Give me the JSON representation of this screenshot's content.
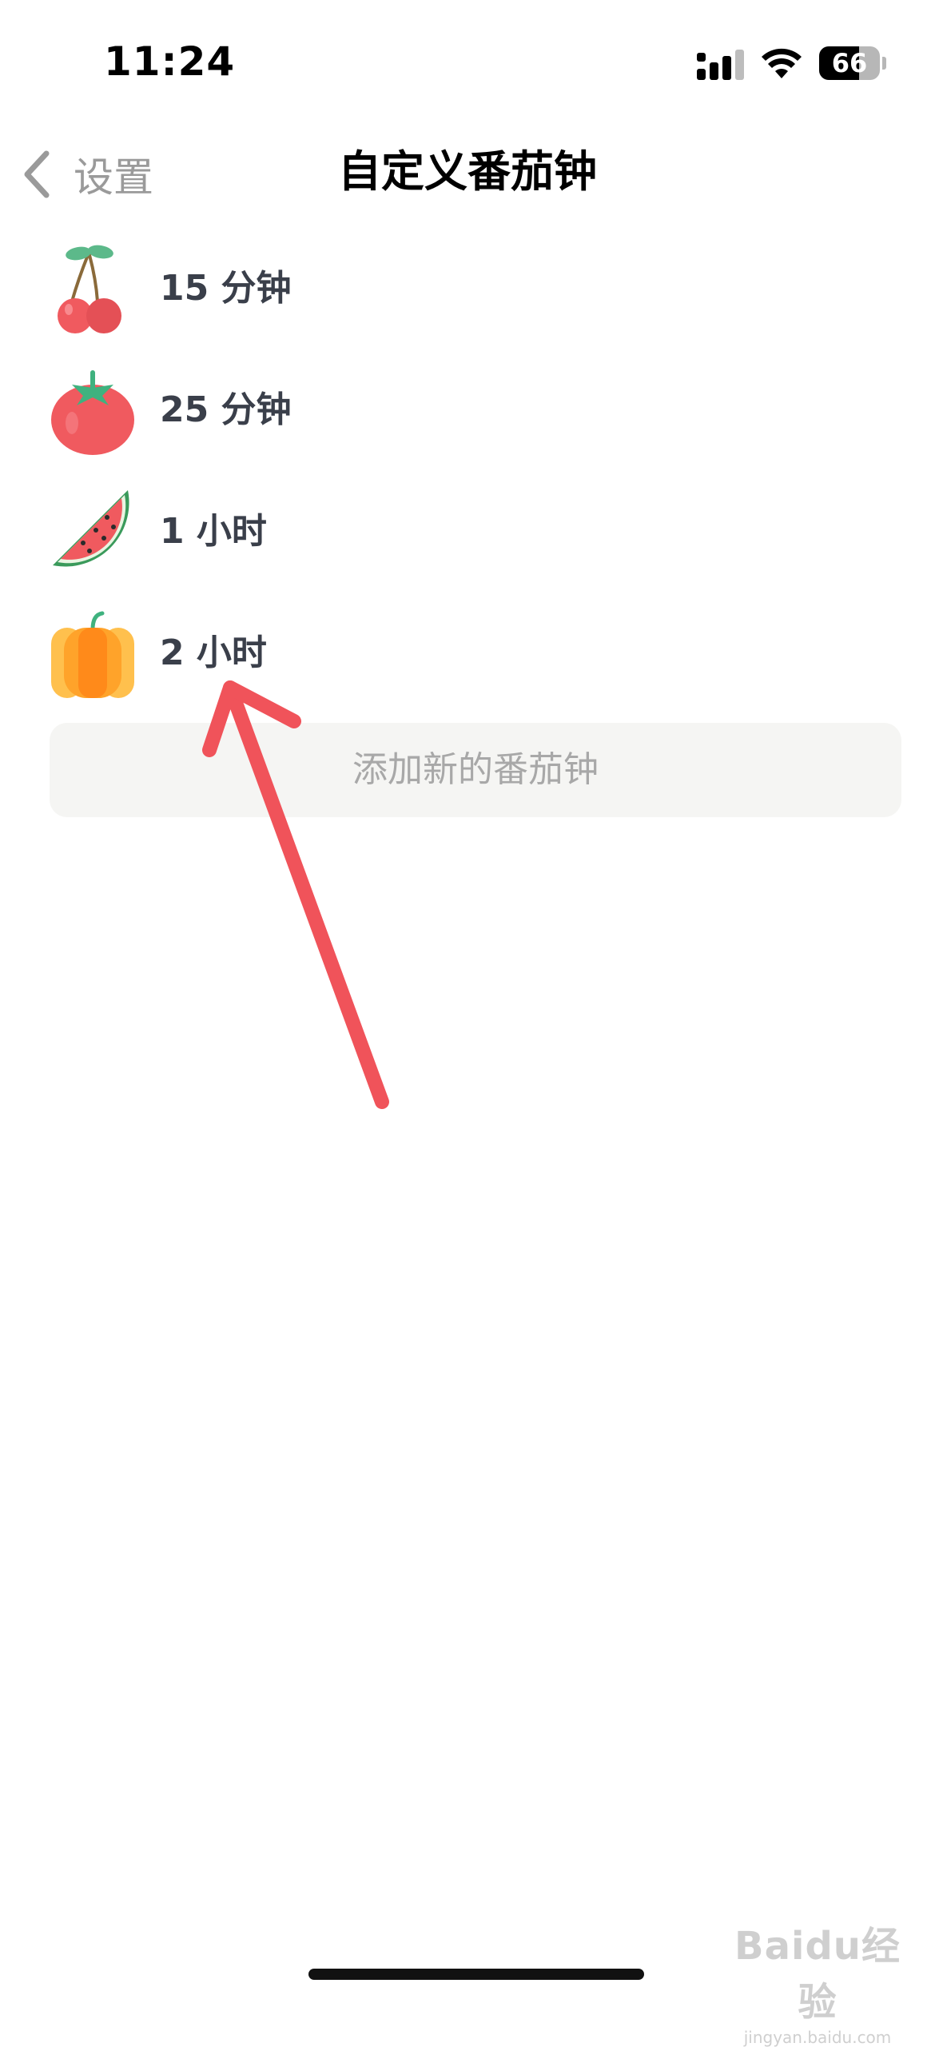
{
  "status_bar": {
    "time": "11:24",
    "battery_level": 66,
    "battery_text": "66",
    "icons": [
      "signal-icon",
      "wifi-icon",
      "battery-icon"
    ]
  },
  "nav": {
    "back_label": "设置",
    "title": "自定义番茄钟"
  },
  "timers": [
    {
      "icon": "cherry-icon",
      "label": "15 分钟"
    },
    {
      "icon": "tomato-icon",
      "label": "25 分钟"
    },
    {
      "icon": "watermelon-icon",
      "label": "1 小时"
    },
    {
      "icon": "pumpkin-icon",
      "label": "2 小时"
    }
  ],
  "add_button": {
    "label": "添加新的番茄钟"
  },
  "annotation": {
    "icon": "arrow-up-icon",
    "color": "#f0535a"
  },
  "watermark": {
    "logo": "Baidu经验",
    "sub": "jingyan.baidu.com"
  },
  "colors": {
    "title": "#000000",
    "label": "#3a3f4a",
    "muted": "#9a9a9a",
    "button_bg": "#f5f5f3",
    "arrow": "#f0535a"
  }
}
